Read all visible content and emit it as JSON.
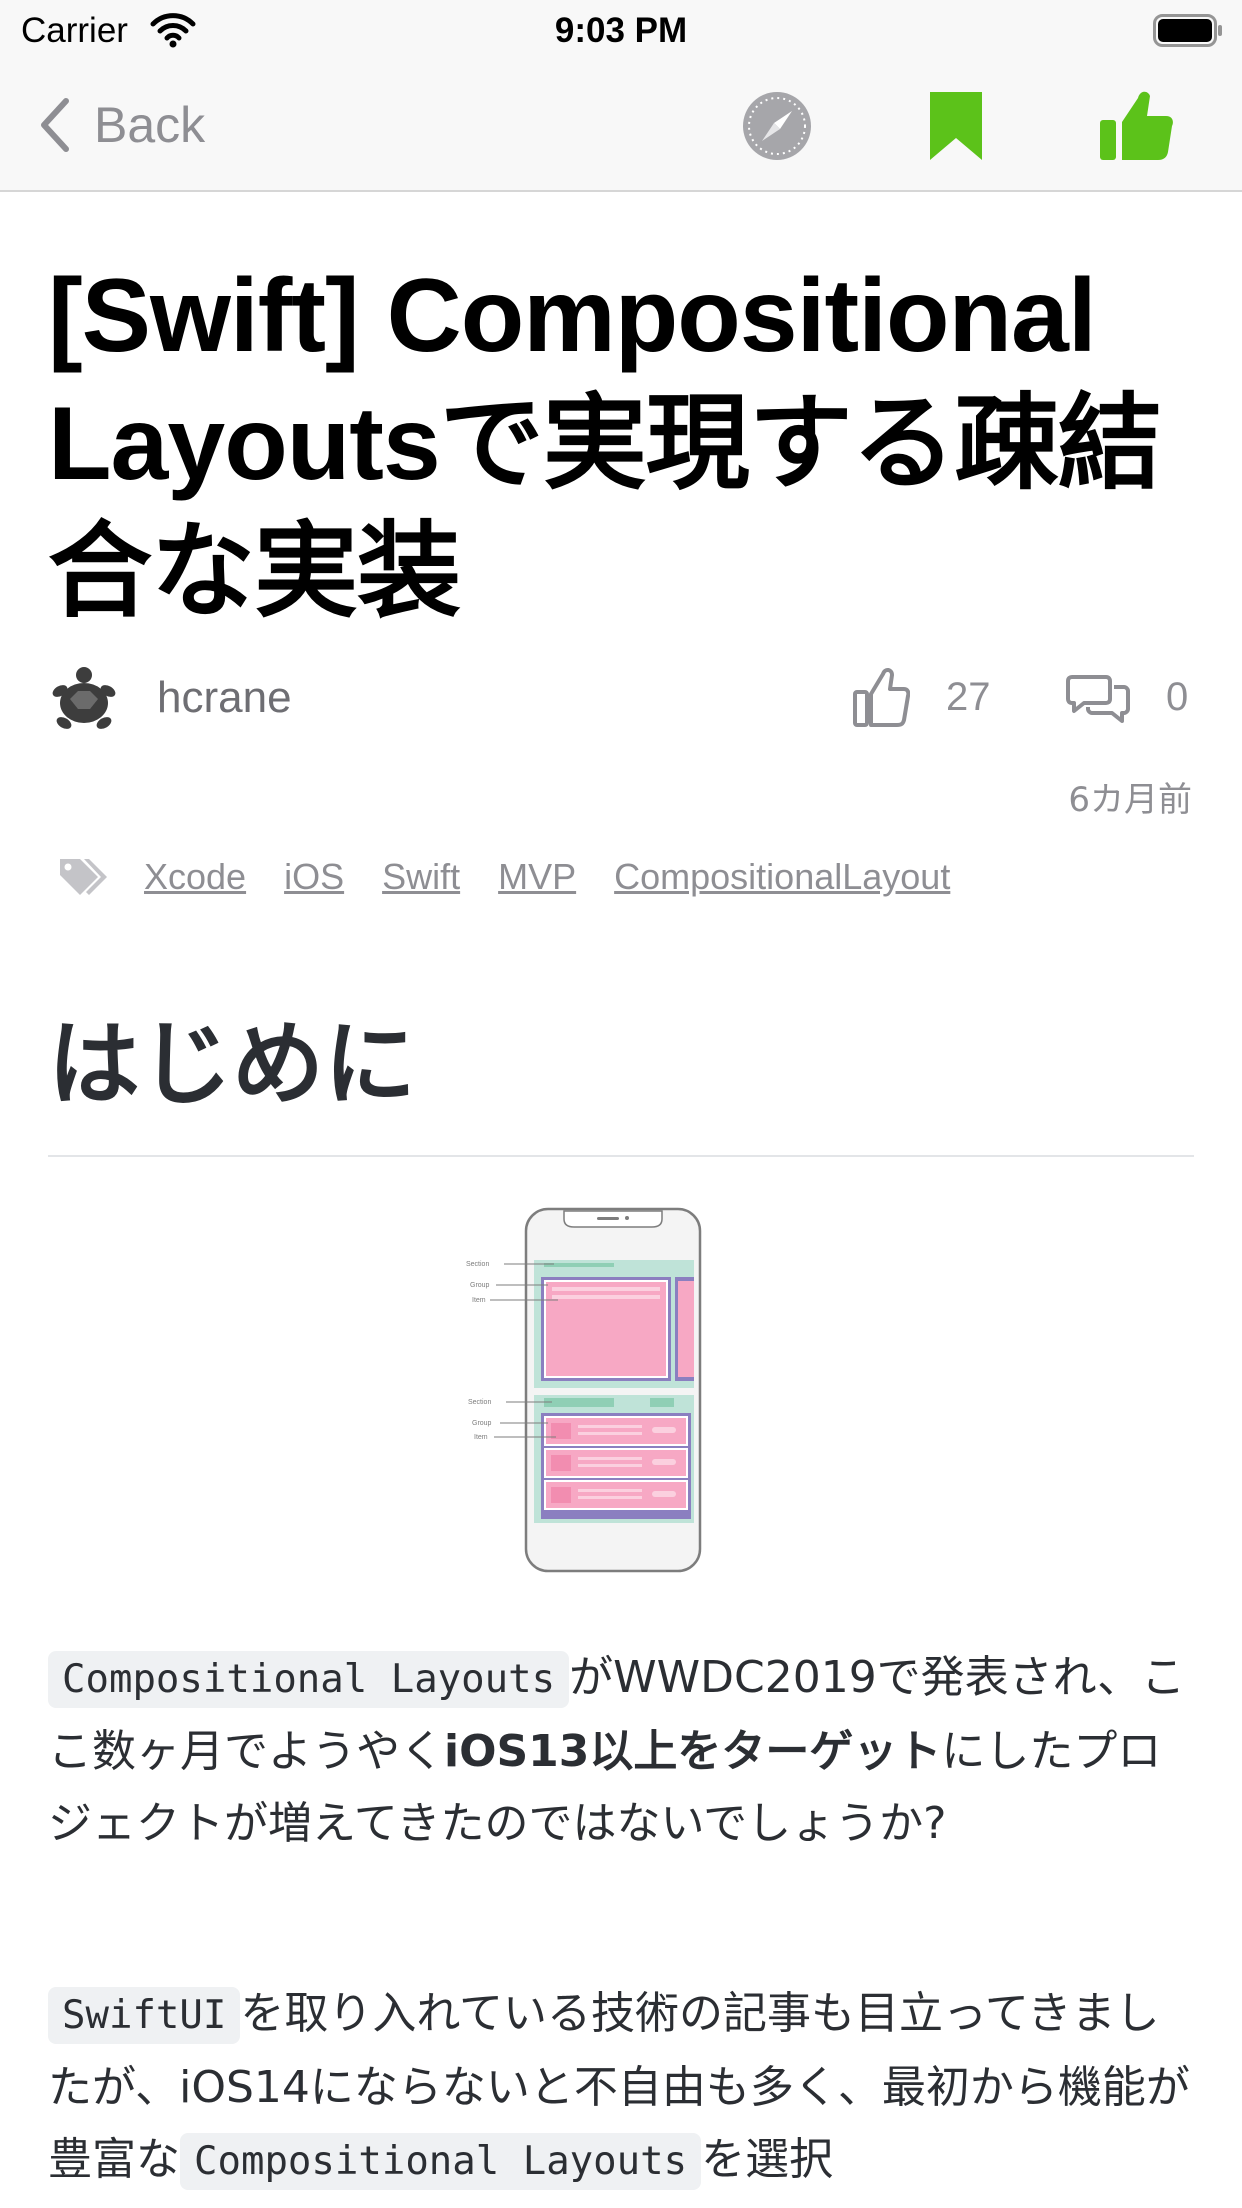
{
  "status_bar": {
    "carrier": "Carrier",
    "time": "9:03 PM"
  },
  "nav": {
    "back_label": "Back",
    "icons": [
      "safari-icon",
      "bookmark-icon",
      "like-icon"
    ],
    "accent_color": "#5cc21a"
  },
  "article": {
    "title": "[Swift] Compositional Layoutsで実現する疎結合な実装",
    "author": "hcrane",
    "likes": "27",
    "comments": "0",
    "date": "6カ月前",
    "tags": [
      "Xcode",
      "iOS",
      "Swift",
      "MVP",
      "CompositionalLayout"
    ]
  },
  "section": {
    "heading": "はじめに"
  },
  "diagram": {
    "label_section_1": "Section",
    "label_group_1": "Group",
    "label_item_1": "Item",
    "label_section_2": "Section",
    "label_group_2": "Group",
    "label_item_2": "Item"
  },
  "paragraph1": {
    "code1": "Compositional Layouts",
    "text1": "がWWDC2019で発表され、ここ数ヶ月でようやく",
    "bold1": "iOS13以上をターゲット",
    "text2": "にしたプロジェクトが増えてきたのではないでしょうか?"
  },
  "paragraph2": {
    "code1": "SwiftUI",
    "text1": "を取り入れている技術の記事も目立ってきましたが、iOS14にならないと不自由も多く、最初から機能が豊富な",
    "code2": "Compositional Layouts",
    "text2": "を選択"
  }
}
